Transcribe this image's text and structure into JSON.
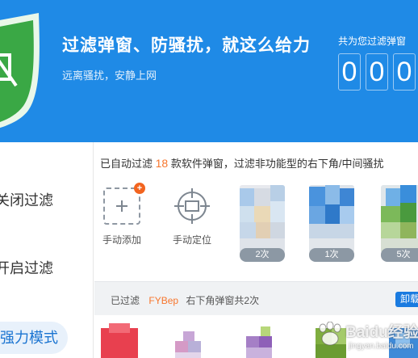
{
  "header": {
    "title": "过滤弹窗、防骚扰，就这么给力",
    "subtitle": "远离骚扰，安静上网",
    "counter_label": "共为您过滤弹窗",
    "digits": [
      "0",
      "0",
      "0"
    ]
  },
  "sidebar": {
    "items": [
      {
        "label": "关闭过滤"
      },
      {
        "label": "开启过滤"
      },
      {
        "label": "强力模式"
      }
    ]
  },
  "main": {
    "summary_prefix": "已自动过滤",
    "summary_count": "18",
    "summary_suffix": "款软件弹窗，过滤非功能型的右下角/中间骚扰",
    "tools": [
      {
        "label": "手动添加",
        "icon": "add-icon",
        "badge": "+"
      },
      {
        "label": "手动定位",
        "icon": "target-icon"
      }
    ],
    "apps": [
      {
        "count": "2次"
      },
      {
        "count": "1次"
      },
      {
        "count": "5次"
      }
    ],
    "filter_bar": {
      "prefix": "已过滤",
      "app_name": "FYBep",
      "detail": "右下角弹窗共2次",
      "action_label": "卸载"
    }
  },
  "watermark": {
    "brand": "Baidu经验",
    "domain": "jingyan.baidu.com"
  },
  "colors": {
    "header_bg": "#1f8ae6",
    "shield_green": "#3aa845",
    "accent_orange": "#f7762d",
    "active_blue": "#1a74d1"
  }
}
